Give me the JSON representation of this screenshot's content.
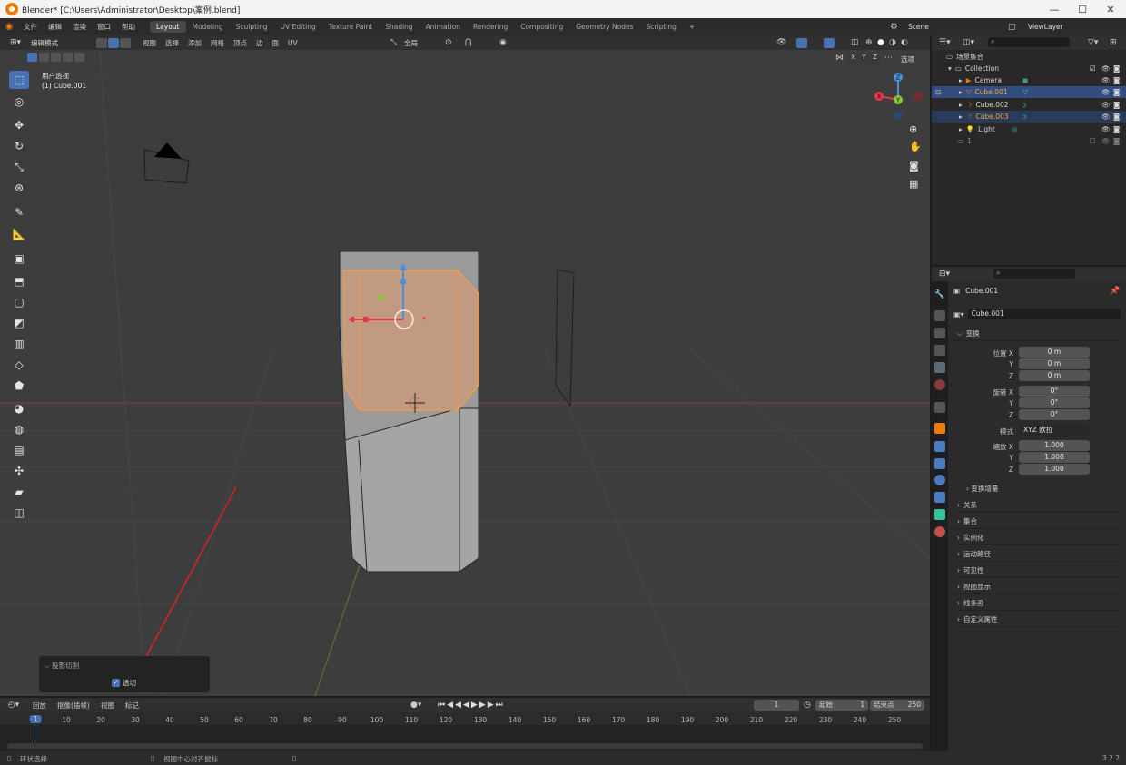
{
  "window": {
    "title": "Blender* [C:\\Users\\Administrator\\Desktop\\案例.blend]"
  },
  "menu": [
    "文件",
    "编辑",
    "渲染",
    "窗口",
    "帮助"
  ],
  "workspaces": [
    "Layout",
    "Modeling",
    "Sculpting",
    "UV Editing",
    "Texture Paint",
    "Shading",
    "Animation",
    "Rendering",
    "Compositing",
    "Geometry Nodes",
    "Scripting"
  ],
  "active_workspace": "Layout",
  "scene": {
    "label": "Scene",
    "view_layer": "ViewLayer"
  },
  "viewport_header": {
    "mode": "编辑模式",
    "menus": [
      "视图",
      "选择",
      "添加",
      "网格",
      "顶点",
      "边",
      "面",
      "UV"
    ],
    "transform": "全局",
    "axes": [
      "X",
      "Y",
      "Z"
    ],
    "options": "选项"
  },
  "viewport": {
    "view_name": "用户透视",
    "object_name": "(1) Cube.001"
  },
  "operator_panel": {
    "title": "投影切割",
    "checkbox_label": "透切",
    "checked": true
  },
  "outliner": {
    "root": "场景集合",
    "collection": "Collection",
    "items": [
      {
        "name": "Camera",
        "type": "camera",
        "selected": false
      },
      {
        "name": "Cube.001",
        "type": "mesh",
        "selected": true
      },
      {
        "name": "Cube.002",
        "type": "mesh",
        "selected": false
      },
      {
        "name": "Cube.003",
        "type": "mesh",
        "selected": true
      },
      {
        "name": "Light",
        "type": "light",
        "selected": false
      }
    ],
    "extra": "1"
  },
  "properties": {
    "object_name": "Cube.001",
    "data_name": "Cube.001",
    "section": "变换",
    "location_label": "位置 X",
    "location": [
      "0 m",
      "0 m",
      "0 m"
    ],
    "rotation_label": "旋转 X",
    "rotation": [
      "0°",
      "0°",
      "0°"
    ],
    "mode_label": "模式",
    "mode_value": "XYZ 欧拉",
    "scale_label": "缩放 X",
    "scale": [
      "1.000",
      "1.000",
      "1.000"
    ],
    "axis_y": "Y",
    "axis_z": "Z",
    "delta": "变换增量",
    "panels": [
      "关系",
      "集合",
      "实例化",
      "运动路径",
      "可见性",
      "视图显示",
      "线条画",
      "自定义属性"
    ]
  },
  "timeline": {
    "menus": [
      "回放",
      "抠像(插帧)",
      "视图",
      "标记"
    ],
    "current_frame": "1",
    "start_label": "起始",
    "start": "1",
    "end_label": "结束点",
    "end": "250",
    "ticks": [
      "1",
      "10",
      "20",
      "30",
      "40",
      "50",
      "60",
      "70",
      "80",
      "90",
      "100",
      "110",
      "120",
      "130",
      "140",
      "150",
      "160",
      "170",
      "180",
      "190",
      "200",
      "210",
      "220",
      "230",
      "240",
      "250"
    ]
  },
  "status": {
    "left": "环状选择",
    "middle": "视图中心对齐鼠标",
    "version": "3.2.2"
  },
  "colors": {
    "accent": "#4772b3",
    "selected": "#f4a640",
    "x_axis": "#e63946",
    "y_axis": "#8cc63f",
    "z_axis": "#4a90d9"
  }
}
